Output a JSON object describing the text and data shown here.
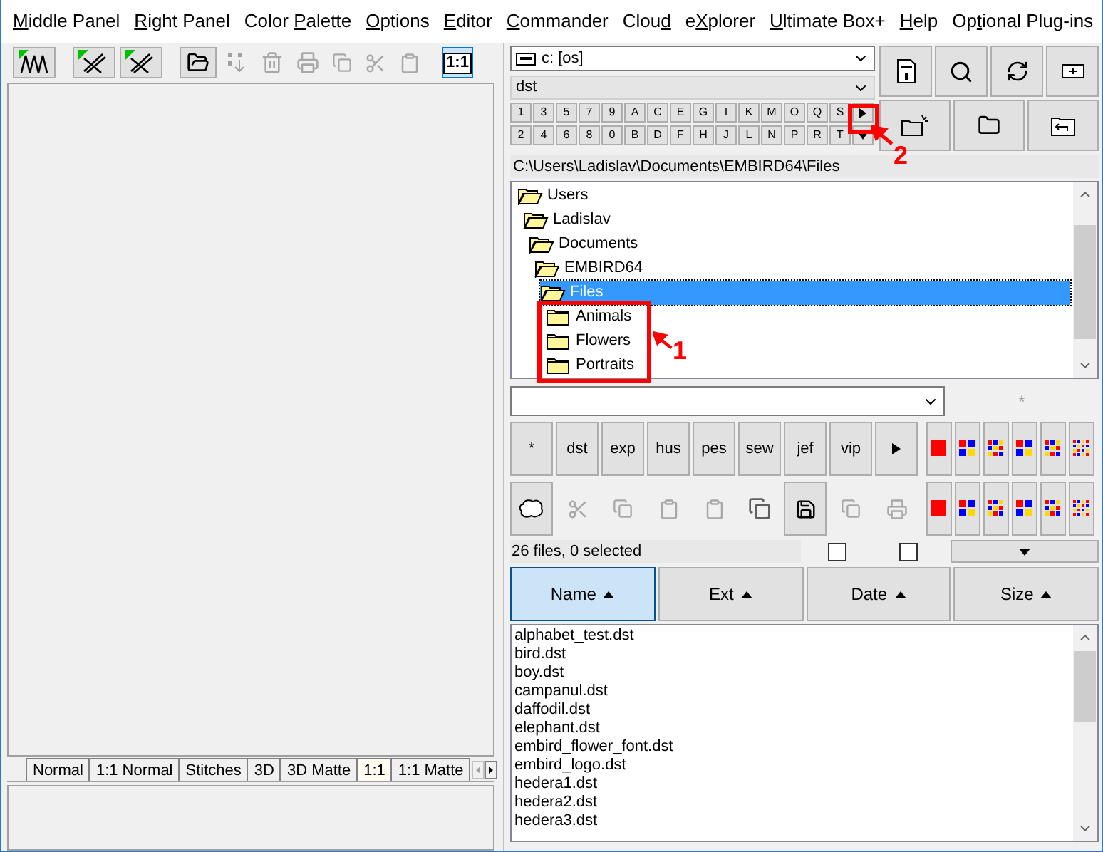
{
  "menu": [
    {
      "accelerator": "M",
      "label_end": "iddle Panel"
    },
    {
      "accelerator": "R",
      "label_end": "ight Panel"
    },
    {
      "label_start": "Color ",
      "accelerator": "P",
      "label_end": "alette"
    },
    {
      "accelerator": "O",
      "label_end": "ptions"
    },
    {
      "accelerator": "E",
      "label_end": "ditor"
    },
    {
      "accelerator": "C",
      "label_end": "ommander"
    },
    {
      "label_start": "Clou",
      "accelerator": "d"
    },
    {
      "label_start": "e",
      "accelerator": "X",
      "label_end": "plorer"
    },
    {
      "accelerator": "U",
      "label_end": "ltimate Box+"
    },
    {
      "accelerator": "H",
      "label_end": "elp"
    },
    {
      "label_start": "Op",
      "accelerator": "t",
      "label_end": "ional Plug-ins"
    }
  ],
  "left_toolbar": {
    "zoom_button": {
      "label": "1:1",
      "selected": true
    }
  },
  "view_tabs": [
    {
      "label": "Normal",
      "selected": false
    },
    {
      "label": "1:1 Normal",
      "selected": false
    },
    {
      "label": "Stitches",
      "selected": false
    },
    {
      "label": "3D",
      "selected": false
    },
    {
      "label": "3D Matte",
      "selected": false
    },
    {
      "label": "1:1",
      "selected": true
    },
    {
      "label": "1:1 Matte",
      "selected": false
    }
  ],
  "drive": {
    "value": "c: [os]"
  },
  "filter": {
    "value": "dst"
  },
  "jump_keys": {
    "row_1": [
      "1",
      "3",
      "5",
      "7",
      "9",
      "A",
      "C",
      "E",
      "G",
      "I",
      "K",
      "M",
      "O",
      "Q",
      "S"
    ],
    "row_2": [
      "2",
      "4",
      "6",
      "8",
      "0",
      "B",
      "D",
      "F",
      "H",
      "J",
      "L",
      "N",
      "P",
      "R",
      "T"
    ]
  },
  "path": "C:\\Users\\Ladislav\\Documents\\EMBIRD64\\Files",
  "folder_tree": [
    {
      "label": "Users",
      "expanded": true,
      "selected": false,
      "children": [
        {
          "label": "Ladislav",
          "expanded": true,
          "selected": false,
          "children": [
            {
              "label": "Documents",
              "expanded": true,
              "selected": false,
              "children": [
                {
                  "label": "EMBIRD64",
                  "expanded": true,
                  "selected": false,
                  "children": [
                    {
                      "label": "Files",
                      "expanded": true,
                      "selected": true,
                      "children": [
                        {
                          "label": "Animals",
                          "expanded": false,
                          "selected": false
                        },
                        {
                          "label": "Flowers",
                          "expanded": false,
                          "selected": false
                        },
                        {
                          "label": "Portraits",
                          "expanded": false,
                          "selected": false
                        }
                      ]
                    }
                  ]
                }
              ]
            }
          ]
        }
      ]
    }
  ],
  "mask_hint": "*",
  "extension_buttons": [
    "*",
    "dst",
    "exp",
    "hus",
    "pes",
    "sew",
    "jef",
    "vip"
  ],
  "status": "26 files, 0 selected",
  "checkboxes": [
    {
      "checked": false
    },
    {
      "checked": false
    }
  ],
  "sort_columns": [
    {
      "label": "Name",
      "selected": true
    },
    {
      "label": "Ext",
      "selected": false
    },
    {
      "label": "Date",
      "selected": false
    },
    {
      "label": "Size",
      "selected": false
    }
  ],
  "files": [
    "alphabet_test.dst",
    "bird.dst",
    "boy.dst",
    "campanul.dst",
    "daffodil.dst",
    "elephant.dst",
    "embird_flower_font.dst",
    "embird_logo.dst",
    "hedera1.dst",
    "hedera2.dst",
    "hedera3.dst"
  ],
  "annotations": [
    {
      "label": "1"
    },
    {
      "label": "2"
    }
  ]
}
